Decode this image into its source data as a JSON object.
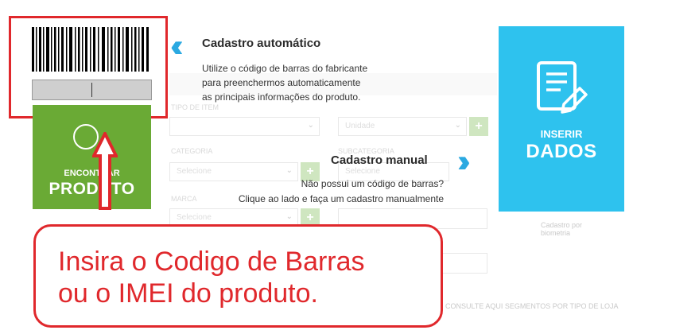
{
  "auto": {
    "title": "Cadastro automático",
    "desc_lines": [
      "Utilize o código de barras do fabricante",
      "para preenchermos automaticamente",
      "as principais informações do produto."
    ]
  },
  "manual": {
    "title": "Cadastro manual",
    "desc_lines": [
      "Não possui um código de barras?",
      "Clique ao lado e faça um cadastro manualmente"
    ]
  },
  "find_product": {
    "line1": "ENCONTRAR",
    "line2": "PRODUTO"
  },
  "insert_data": {
    "line1": "INSERIR",
    "line2": "DADOS"
  },
  "callout": {
    "lines": [
      "Insira o Codigo de Barras",
      "ou o IMEI do produto."
    ]
  },
  "background_form": {
    "tipo_label": "TIPO DE ITEM",
    "unidade_value": "Unidade",
    "categoria_label": "CATEGORIA",
    "categoria_value": "Selecione",
    "subcategoria_label": "SUBCATEGORIA",
    "subcategoria_value": "Selecione",
    "marca_label": "MARCA",
    "marca_value": "Selecione",
    "footer_text": "CONSULTE AQUI SEGMENTOS POR TIPO DE LOJA",
    "biometria_text": "Cadastro por biometria"
  },
  "colors": {
    "accent_red": "#e0282c",
    "green": "#6aaa35",
    "blue": "#2ec2ee",
    "chevron_blue": "#2ba9e1"
  }
}
